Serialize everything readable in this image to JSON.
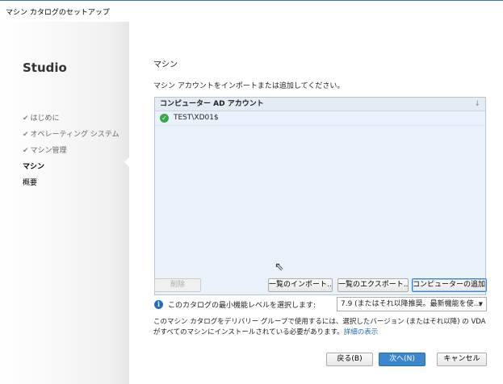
{
  "window": {
    "title": "マシン カタログのセットアップ"
  },
  "sidebar": {
    "brand": "Studio",
    "steps": [
      {
        "label": "はじめに",
        "state": "done"
      },
      {
        "label": "オペレーティング システム",
        "state": "done"
      },
      {
        "label": "マシン管理",
        "state": "done"
      },
      {
        "label": "マシン",
        "state": "current"
      },
      {
        "label": "概要",
        "state": "future"
      }
    ],
    "check_glyph": "✔"
  },
  "main": {
    "section_title": "マシン",
    "instruction": "マシン アカウントをインポートまたは追加してください。",
    "list": {
      "column_header": "コンピューター AD アカウント",
      "sort_glyph": "↓",
      "rows": [
        {
          "name": "TEST\\XD01$",
          "status": "ok"
        }
      ]
    },
    "buttons": {
      "delete": "削除",
      "import": "一覧のインポート...",
      "export": "一覧のエクスポート...",
      "add_computer": "コンピューターの追加..."
    },
    "functional_level": {
      "label": "このカタログの最小機能レベルを選択します:",
      "selected": "7.9 (またはそれ以降推奨。最新機能を使..."
    },
    "note": {
      "text": "このマシン カタログをデリバリー グループで使用するには、選択したバージョン (またはそれ以降) の VDA がすべてのマシンにインストールされている必要があります。",
      "link": "詳細の表示"
    },
    "nav": {
      "back": "戻る(B)",
      "next": "次へ(N)",
      "cancel": "キャンセル"
    }
  },
  "colors": {
    "accent": "#3a86cf",
    "ok": "#38a844",
    "info": "#1f6dc1",
    "list_bg": "#e9f2fb"
  }
}
